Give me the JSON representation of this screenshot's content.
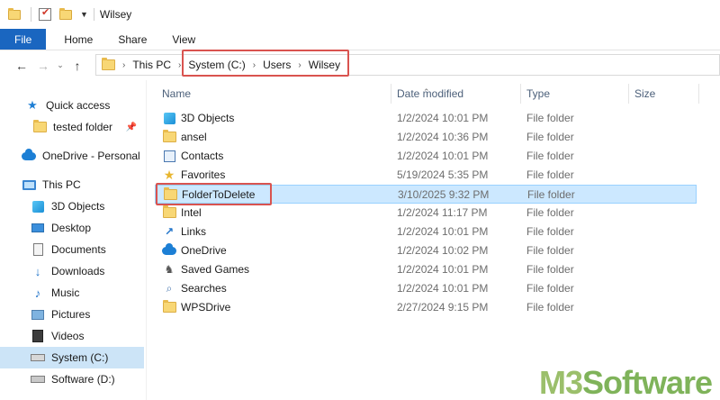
{
  "window": {
    "title": "Wilsey"
  },
  "ribbon": {
    "tabs": [
      "File",
      "Home",
      "Share",
      "View"
    ]
  },
  "address": {
    "crumbs": [
      "This PC",
      "System (C:)",
      "Users",
      "Wilsey"
    ]
  },
  "nav": {
    "items": [
      {
        "label": "Quick access",
        "icon": "star-icon"
      },
      {
        "label": "tested folder",
        "icon": "folder-icon",
        "pinned": true
      },
      {
        "label": "OneDrive - Personal",
        "icon": "onedrive-icon"
      },
      {
        "label": "This PC",
        "icon": "computer-icon"
      },
      {
        "label": "3D Objects",
        "icon": "cube-icon"
      },
      {
        "label": "Desktop",
        "icon": "desktop-icon"
      },
      {
        "label": "Documents",
        "icon": "documents-icon"
      },
      {
        "label": "Downloads",
        "icon": "download-icon"
      },
      {
        "label": "Music",
        "icon": "music-icon"
      },
      {
        "label": "Pictures",
        "icon": "pictures-icon"
      },
      {
        "label": "Videos",
        "icon": "videos-icon"
      },
      {
        "label": "System (C:)",
        "icon": "drive-icon",
        "selected": true
      },
      {
        "label": "Software (D:)",
        "icon": "drive-icon"
      }
    ]
  },
  "columns": {
    "name": "Name",
    "date": "Date modified",
    "type": "Type",
    "size": "Size"
  },
  "files": [
    {
      "name": "3D Objects",
      "date": "1/2/2024 10:01 PM",
      "type": "File folder",
      "icon": "cube-icon"
    },
    {
      "name": "ansel",
      "date": "1/2/2024 10:36 PM",
      "type": "File folder",
      "icon": "folder-icon"
    },
    {
      "name": "Contacts",
      "date": "1/2/2024 10:01 PM",
      "type": "File folder",
      "icon": "contacts-icon"
    },
    {
      "name": "Favorites",
      "date": "5/19/2024 5:35 PM",
      "type": "File folder",
      "icon": "star-icon"
    },
    {
      "name": "FolderToDelete",
      "date": "3/10/2025 9:32 PM",
      "type": "File folder",
      "icon": "folder-icon",
      "selected": true
    },
    {
      "name": "Intel",
      "date": "1/2/2024 11:17 PM",
      "type": "File folder",
      "icon": "folder-icon"
    },
    {
      "name": "Links",
      "date": "1/2/2024 10:01 PM",
      "type": "File folder",
      "icon": "links-icon"
    },
    {
      "name": "OneDrive",
      "date": "1/2/2024 10:02 PM",
      "type": "File folder",
      "icon": "onedrive-icon"
    },
    {
      "name": "Saved Games",
      "date": "1/2/2024 10:01 PM",
      "type": "File folder",
      "icon": "saved-games-icon"
    },
    {
      "name": "Searches",
      "date": "1/2/2024 10:01 PM",
      "type": "File folder",
      "icon": "search-icon"
    },
    {
      "name": "WPSDrive",
      "date": "2/27/2024 9:15 PM",
      "type": "File folder",
      "icon": "folder-icon"
    }
  ],
  "watermark": {
    "prefix": "M3",
    "suffix": "Software"
  }
}
